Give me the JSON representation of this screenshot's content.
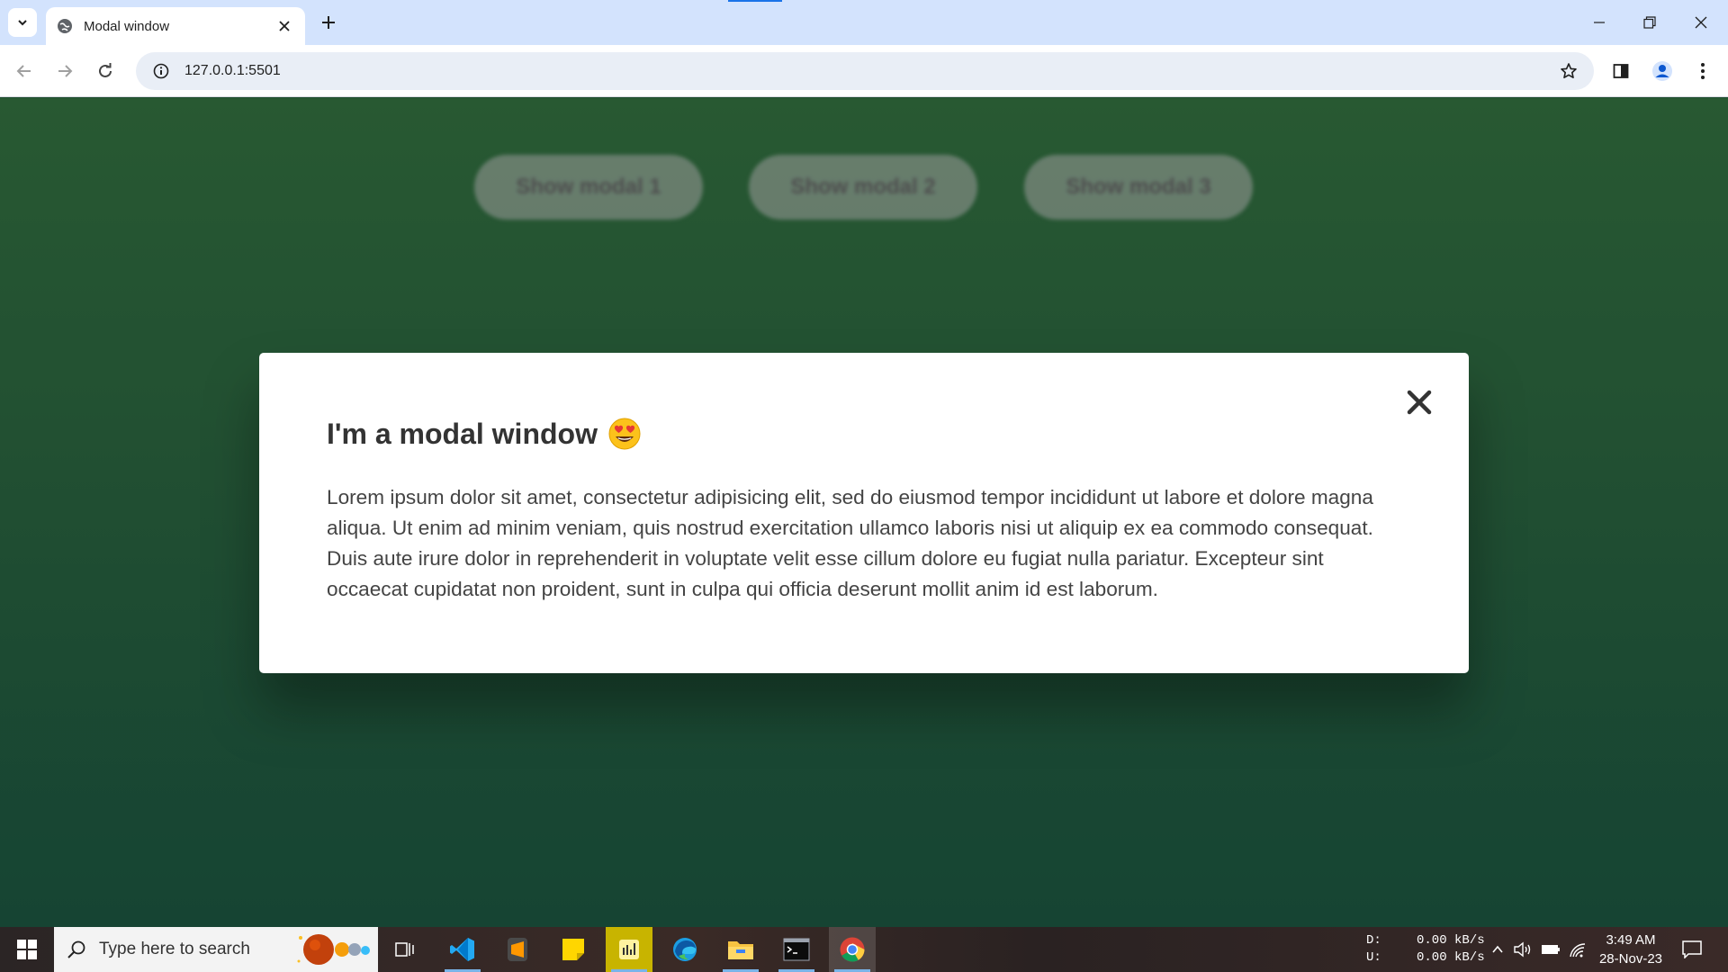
{
  "browser": {
    "tab_title": "Modal window",
    "url": "127.0.0.1:5501"
  },
  "page": {
    "buttons": [
      "Show modal 1",
      "Show modal 2",
      "Show modal 3"
    ],
    "modal": {
      "title": "I'm a modal window",
      "title_emoji": "smiling-face-with-heart-eyes",
      "body": "Lorem ipsum dolor sit amet, consectetur adipisicing elit, sed do eiusmod tempor incididunt ut labore et dolore magna aliqua. Ut enim ad minim veniam, quis nostrud exercitation ullamco laboris nisi ut aliquip ex ea commodo consequat. Duis aute irure dolor in reprehenderit in voluptate velit esse cillum dolore eu fugiat nulla pariatur. Excepteur sint occaecat cupidatat non proident, sunt in culpa qui officia deserunt mollit anim id est laborum.",
      "close_symbol": "×"
    },
    "colors": {
      "background_top": "#2c6137",
      "background_bottom": "#184a38"
    }
  },
  "taskbar": {
    "search_placeholder": "Type here to search",
    "net_down_label": "D:",
    "net_up_label": "U:",
    "net_down": "0.00 kB/s",
    "net_up": "0.00 kB/s",
    "time": "3:49 AM",
    "date": "28-Nov-23",
    "apps": [
      "task-view",
      "vscode",
      "sublime-text",
      "sticky-notes",
      "yellow-app",
      "edge",
      "file-explorer",
      "terminal",
      "chrome"
    ]
  }
}
